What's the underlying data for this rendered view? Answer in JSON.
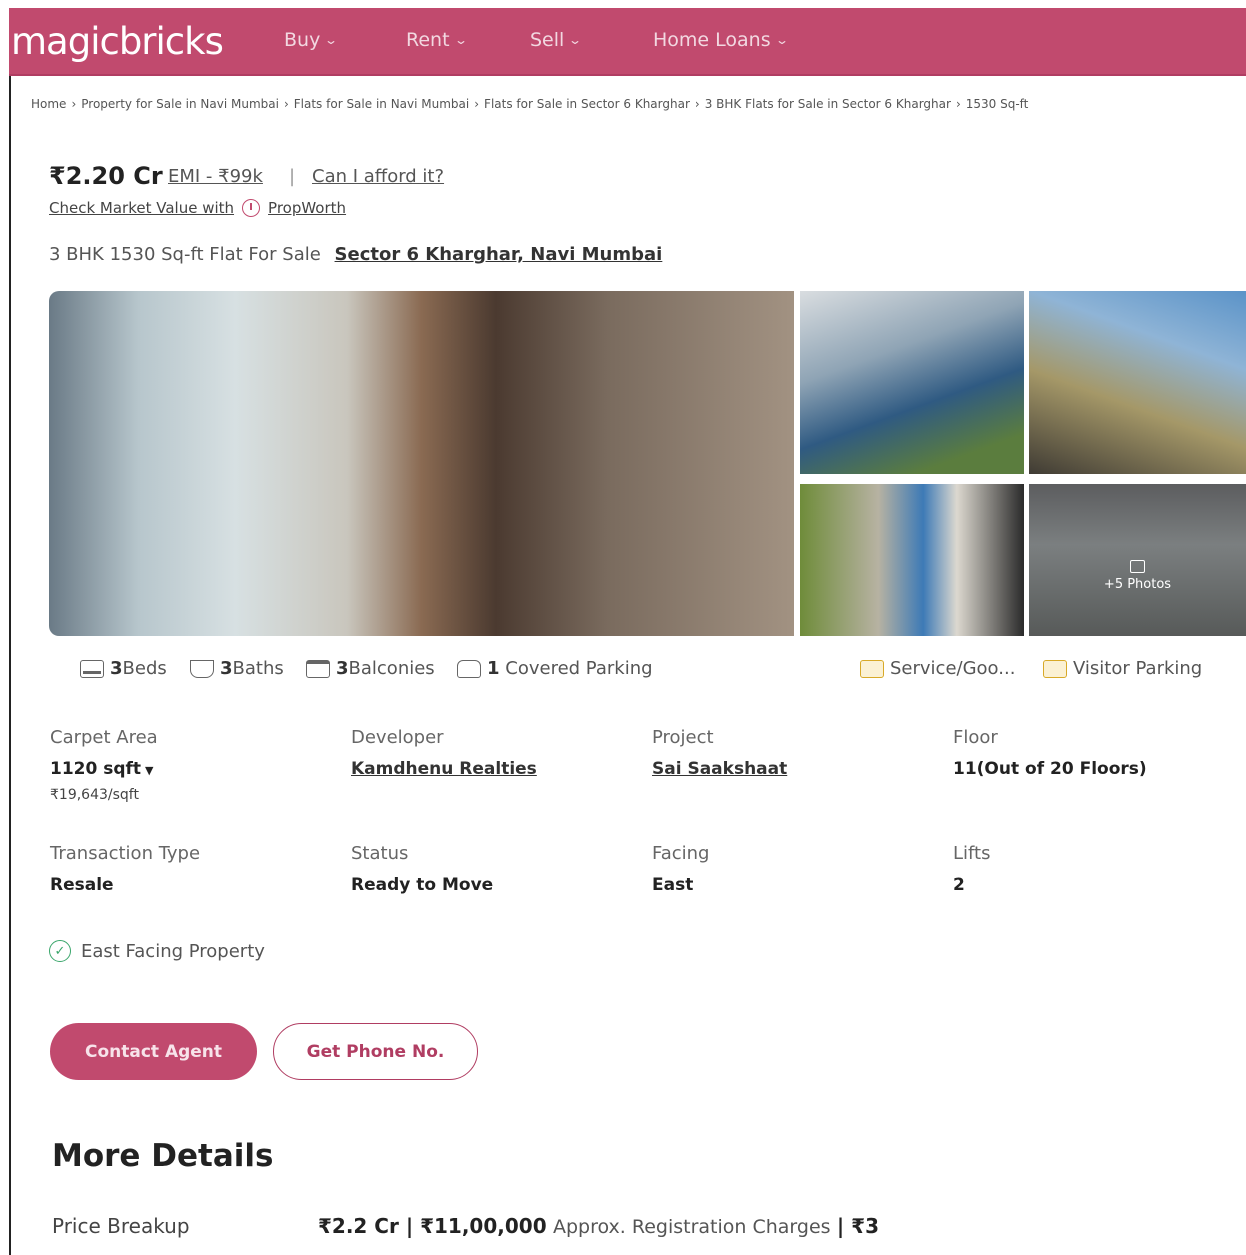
{
  "header": {
    "logo": "magicbricks",
    "nav": [
      {
        "label": "Buy"
      },
      {
        "label": "Rent"
      },
      {
        "label": "Sell"
      },
      {
        "label": "Home Loans"
      }
    ]
  },
  "breadcrumb": [
    "Home",
    "Property for Sale in Navi Mumbai",
    "Flats for Sale in Navi Mumbai",
    "Flats for Sale in Sector 6 Kharghar",
    "3 BHK Flats for Sale in Sector 6 Kharghar",
    "1530 Sq-ft"
  ],
  "price": {
    "amount": "₹2.20 Cr",
    "emi": "EMI - ₹99k",
    "afford": "Can I afford it?",
    "market_value": "Check Market Value with",
    "propworth": "PropWorth"
  },
  "listing": {
    "title": "3 BHK 1530 Sq-ft Flat For Sale",
    "location": "Sector 6 Kharghar, Navi Mumbai"
  },
  "gallery": {
    "more_photos": "+5 Photos"
  },
  "amenities": {
    "beds_count": "3",
    "beds_label": "Beds",
    "baths_count": "3",
    "baths_label": "Baths",
    "balconies_count": "3",
    "balconies_label": "Balconies",
    "parking_count": "1",
    "parking_label": "Covered Parking",
    "service": "Service/Goo...",
    "visitor": "Visitor Parking"
  },
  "details": {
    "carpet_area_label": "Carpet Area",
    "carpet_area_value": "1120 sqft",
    "carpet_area_rate": "₹19,643/sqft",
    "developer_label": "Developer",
    "developer_value": "Kamdhenu Realties",
    "project_label": "Project",
    "project_value": "Sai Saakshaat",
    "floor_label": "Floor",
    "floor_value": "11(Out of 20 Floors)",
    "transaction_label": "Transaction Type",
    "transaction_value": "Resale",
    "status_label": "Status",
    "status_value": "Ready to Move",
    "facing_label": "Facing",
    "facing_value": "East",
    "lifts_label": "Lifts",
    "lifts_value": "2"
  },
  "highlight": "East Facing Property",
  "buttons": {
    "contact": "Contact Agent",
    "phone": "Get Phone No."
  },
  "more_details": {
    "title": "More Details",
    "price_breakup_label": "Price Breakup",
    "price_breakup_main": "₹2.2 Cr | ₹11,00,000",
    "price_breakup_note": "Approx. Registration Charges",
    "price_breakup_tail": "| ₹3"
  }
}
